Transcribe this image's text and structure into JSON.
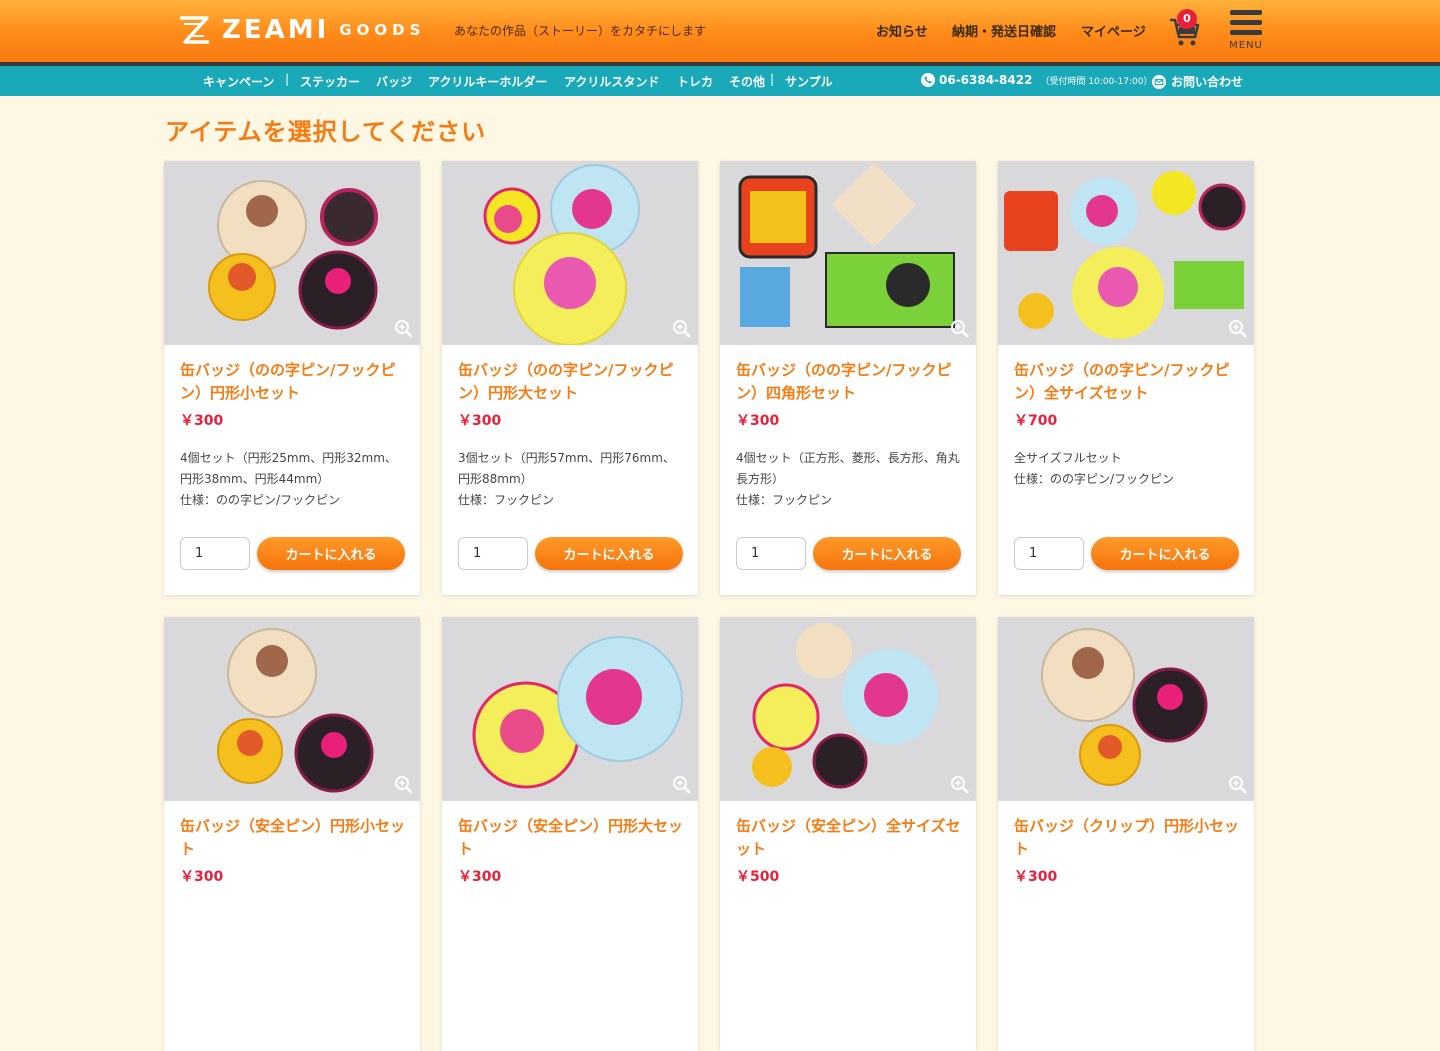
{
  "header": {
    "logo_text": "ZEAMI",
    "logo_sub": "GOODS",
    "tagline": "あなたの作品（ストーリー）をカタチにします",
    "nav": [
      "お知らせ",
      "納期・発送日確認",
      "マイページ"
    ],
    "cart_count": "0",
    "menu_label": "MENU"
  },
  "subnav": {
    "items": [
      "キャンペーン",
      "ステッカー",
      "バッジ",
      "アクリルキーホルダー",
      "アクリルスタンド",
      "トレカ",
      "その他",
      "サンプル"
    ],
    "phone": "06-6384-8422",
    "hours": "（受付時間 10:00-17:00）",
    "contact": "お問い合わせ"
  },
  "main": {
    "title": "アイテムを選択してください",
    "cart_button_label": "カートに入れる",
    "products": [
      {
        "title": "缶バッジ（のの字ピン/フックピン）円形小セット",
        "price": "￥300",
        "desc1": "4個セット（円形25mm、円形32mm、円形38mm、円形44mm）",
        "desc2": "仕様：のの字ピン/フックピン",
        "qty": "1"
      },
      {
        "title": "缶バッジ（のの字ピン/フックピン）円形大セット",
        "price": "￥300",
        "desc1": "3個セット（円形57mm、円形76mm、円形88mm）",
        "desc2": "仕様：フックピン",
        "qty": "1"
      },
      {
        "title": "缶バッジ（のの字ピン/フックピン）四角形セット",
        "price": "￥300",
        "desc1": "4個セット（正方形、菱形、長方形、角丸長方形）",
        "desc2": "仕様：フックピン",
        "qty": "1"
      },
      {
        "title": "缶バッジ（のの字ピン/フックピン）全サイズセット",
        "price": "￥700",
        "desc1": "全サイズフルセット",
        "desc2": "仕様：のの字ピン/フックピン",
        "qty": "1"
      },
      {
        "title": "缶バッジ（安全ピン）円形小セット",
        "price": "￥300"
      },
      {
        "title": "缶バッジ（安全ピン）円形大セット",
        "price": "￥300"
      },
      {
        "title": "缶バッジ（安全ピン）全サイズセット",
        "price": "￥500"
      },
      {
        "title": "缶バッジ（クリップ）円形小セット",
        "price": "￥300"
      }
    ]
  },
  "colors": {
    "header_orange": "#ff8a1a",
    "subnav_teal": "#1aa9b8",
    "title_orange": "#f57c14",
    "price_red": "#e8203a",
    "page_bg": "#fdf7e4"
  },
  "icons": [
    "logo-mark-icon",
    "cart-icon",
    "menu-icon",
    "phone-icon",
    "mail-icon",
    "zoom-icon"
  ]
}
